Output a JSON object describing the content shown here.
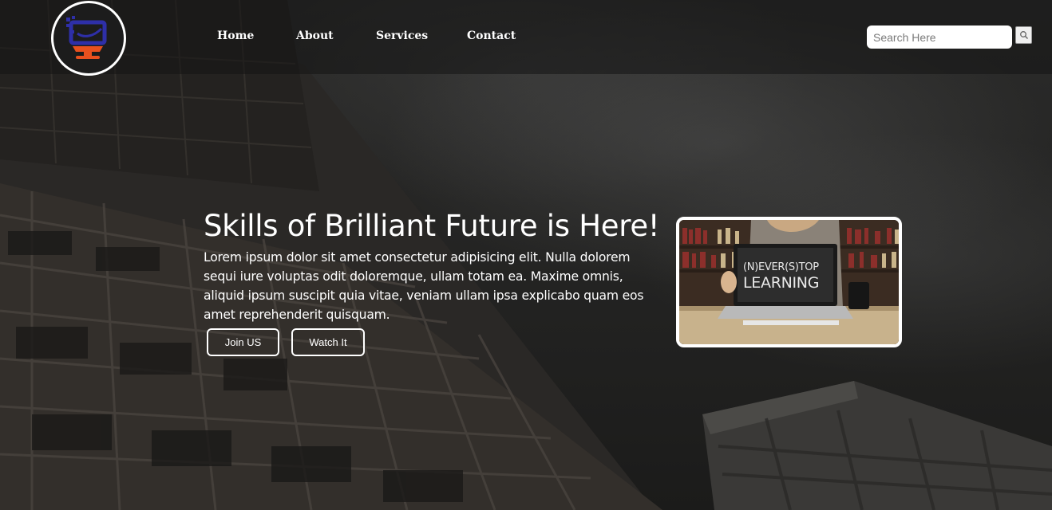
{
  "nav": {
    "items": [
      "Home",
      "About",
      "Services",
      "Contact"
    ]
  },
  "search": {
    "placeholder": "Search Here"
  },
  "hero": {
    "title": "Skills of Brilliant Future is Here!",
    "text": "Lorem ipsum dolor sit amet consectetur adipisicing elit. Nulla dolorem sequi iure voluptas odit doloremque, ullam totam ea. Maxime omnis, aliquid ipsum suscipit quia vitae, veniam ullam ipsa explicabo quam eos amet reprehenderit quisquam.",
    "buttons": {
      "join": "Join US",
      "watch": "Watch It"
    }
  },
  "image": {
    "chalk_line1": "(N)EVER(S)TOP",
    "chalk_line2": "LEARNING"
  },
  "icons": {
    "logo": "monitor-logo-icon",
    "search": "search-icon"
  },
  "colors": {
    "logo_blue": "#2e2fa8",
    "logo_orange": "#e8501e"
  }
}
